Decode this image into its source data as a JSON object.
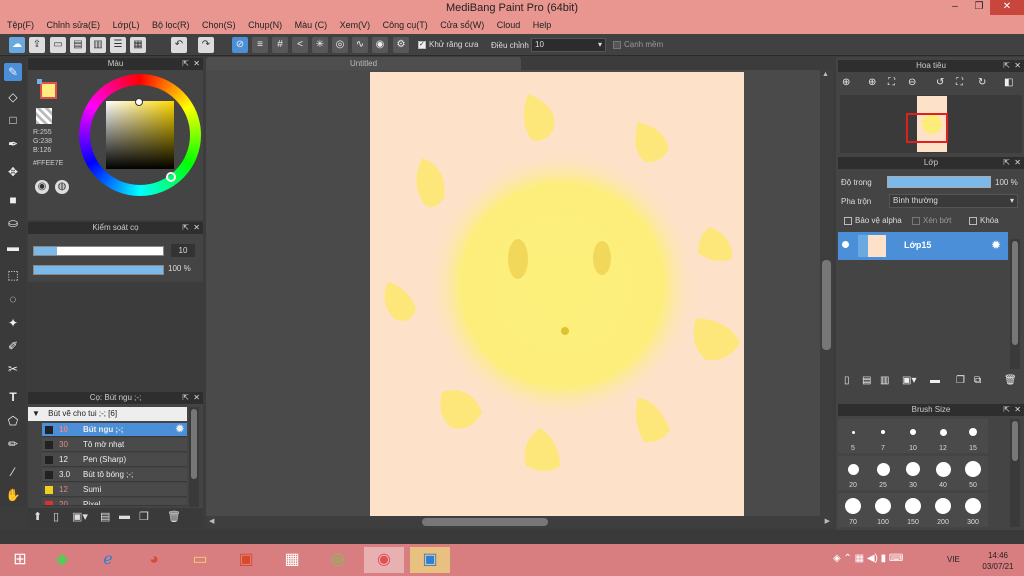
{
  "window": {
    "title": "MediBang Paint Pro (64bit)",
    "minimize": "–",
    "restore": "❐",
    "close": "✕"
  },
  "menu": [
    "Tệp(F)",
    "Chỉnh sửa(E)",
    "Lớp(L)",
    "Bộ lọc(R)",
    "Chọn(S)",
    "Chụp(N)",
    "Màu (C)",
    "Xem(V)",
    "Công cụ(T)",
    "Cửa sổ(W)",
    "Cloud",
    "Help"
  ],
  "toolbar": {
    "antialias_label": "Khử răng cưa",
    "adjust_label": "Điều chỉnh",
    "adjust_value": "10",
    "soft_edge_label": "Cạnh mềm"
  },
  "color_panel": {
    "title": "Màu",
    "r": "R:255",
    "g": "G:238",
    "b": "B:126",
    "hex": "#FFEE7E",
    "main_color": "#FFEE7E"
  },
  "brush_control": {
    "title": "Kiểm soát cọ",
    "size_value": "10",
    "opacity_value": "100 %"
  },
  "brush_list": {
    "title": "Cọ: Bút ngu ;-;",
    "group": "Bút vẽ cho tui ;-; [6]",
    "items": [
      {
        "size": "10",
        "name": "Bút ngu ;-;",
        "color": "#2a2a2a"
      },
      {
        "size": "30",
        "name": "Tô mờ nhạt",
        "color": "#2a2a2a"
      },
      {
        "size": "12",
        "name": "Pen (Sharp)",
        "color": "#2a2a2a"
      },
      {
        "size": "3.0",
        "name": "Bút tô bóng ;-;",
        "color": "#2a2a2a"
      },
      {
        "size": "12",
        "name": "Sumi",
        "color": "#f0d020"
      },
      {
        "size": "20",
        "name": "Pixel",
        "color": "#e03030"
      }
    ]
  },
  "canvas": {
    "tab_title": "Untitled",
    "paper_color": "#FDE2C9"
  },
  "navigator": {
    "title": "Hoa tiêu"
  },
  "layers": {
    "title": "Lớp",
    "opacity_label": "Độ trong",
    "opacity_value": "100 %",
    "blend_label": "Pha trộn",
    "blend_value": "Bình thường",
    "protect_alpha": "Bảo vệ alpha",
    "clipping": "Xén bớt",
    "lock": "Khóa",
    "layer_name": "Lớp15"
  },
  "brush_size": {
    "title": "Brush Size",
    "sizes": [
      "5",
      "7",
      "10",
      "12",
      "15",
      "20",
      "25",
      "30",
      "40",
      "50",
      "70",
      "100",
      "150",
      "200",
      "300"
    ]
  },
  "taskbar": {
    "language": "VIE",
    "time": "14:46",
    "date": "03/07/21"
  }
}
